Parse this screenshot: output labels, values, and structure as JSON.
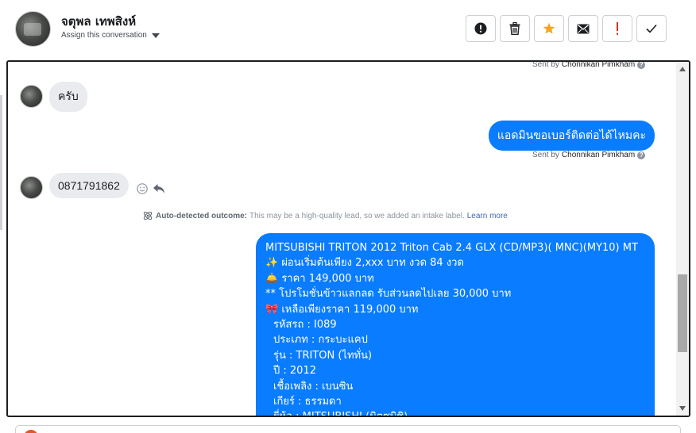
{
  "header": {
    "contact_name": "จตุพล เทพสิงห์",
    "assign_label": "Assign this conversation"
  },
  "actions": [
    {
      "name": "info-button",
      "icon": "exclamation-circle-icon",
      "color": "#1c1e21"
    },
    {
      "name": "delete-button",
      "icon": "trash-icon",
      "color": "#1c1e21"
    },
    {
      "name": "star-button",
      "icon": "star-icon",
      "color": "#f5a623"
    },
    {
      "name": "mail-button",
      "icon": "envelope-icon",
      "color": "#1c1e21"
    },
    {
      "name": "flag-important-button",
      "icon": "exclamation-icon",
      "color": "#d93025"
    },
    {
      "name": "done-button",
      "icon": "checkmark-icon",
      "color": "#1c1e21"
    }
  ],
  "chat": {
    "sent_by_prefix": "Sent by",
    "sent_by_name": "Chonnikan Pimkham",
    "messages": {
      "in1": "ครับ",
      "out1": "แอดมินขอเบอร์ติดต่อได้ไหมคะ",
      "in2": "0871791862"
    },
    "auto_outcome": {
      "title": "Auto-detected outcome:",
      "text": "This may be a high-quality lead, so we added an intake label.",
      "link": "Learn more"
    },
    "listing": [
      "MITSUBISHI TRITON 2012 Triton Cab 2.4 GLX (CD/MP3)( MNC)(MY10) MT",
      "✨  ผ่อนเริ่มต้นเพียง 2,xxx บาท งวด 84 งวด",
      "🛎️  ราคา 149,000 บาท",
      "** โปรโมชั่นข้าวแลกลด รับส่วนลดไปเลย 30,000 บาท",
      "🎀  เหลือเพียงราคา 119,000 บาท",
      "รหัสรถ : I089",
      "ประเภท : กระบะแคป",
      "รุ่น : TRITON (ไททั่น)",
      "ปี : 2012",
      "เชื้อเพลิง : เบนซิน",
      "เกียร์ : ธรรมดา",
      "ยี่ห้อ : MITSUBISHI (มิตซูบิชิ)"
    ]
  },
  "colors": {
    "outgoing_bubble": "#0a7cff",
    "incoming_bubble": "#e9ebee",
    "link": "#4267b2"
  }
}
